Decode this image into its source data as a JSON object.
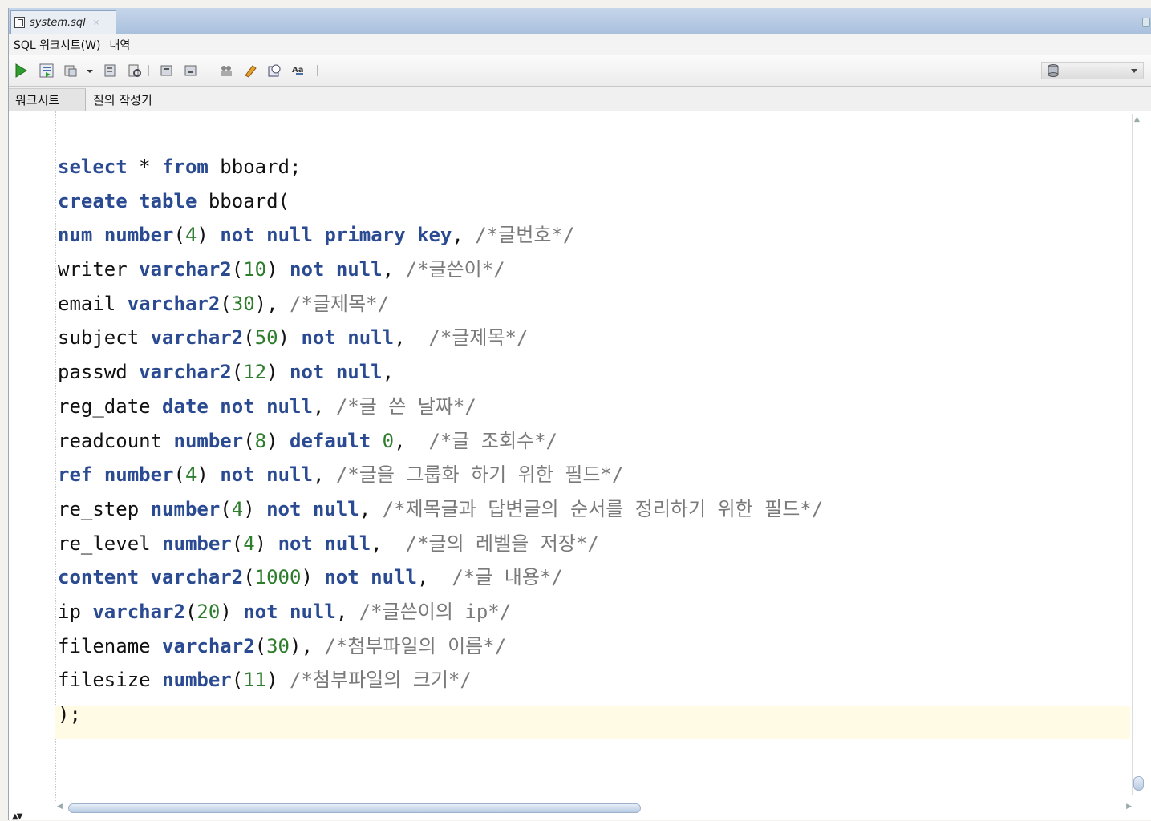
{
  "file_tab": {
    "name": "system.sql",
    "close": "×",
    "icon": "sql-file-icon"
  },
  "menu": {
    "items": [
      "SQL 워크시트(W)",
      "내역"
    ]
  },
  "toolbar": {
    "buttons": [
      "run-statement-icon",
      "run-script-icon",
      "autotrace-icon",
      "dropdown-icon",
      "explain-plan-icon",
      "sql-tuning-icon",
      "commit-icon",
      "rollback-icon",
      "unshared-worksheet-icon",
      "clear-icon",
      "sql-history-icon",
      "format-icon"
    ],
    "connection_icon": "database-icon",
    "connection_value": ""
  },
  "subtabs": {
    "worksheet": "워크시트",
    "query_builder": "질의 작성기"
  },
  "editor": {
    "lines": [
      [
        [
          "kw",
          "select"
        ],
        [
          "t",
          " * "
        ],
        [
          "kw",
          "from"
        ],
        [
          "t",
          " bboard;"
        ]
      ],
      [
        [
          "kw",
          "create"
        ],
        [
          "t",
          " "
        ],
        [
          "kw",
          "table"
        ],
        [
          "t",
          " bboard("
        ]
      ],
      [
        [
          "kw",
          "num"
        ],
        [
          "t",
          " "
        ],
        [
          "kw",
          "number"
        ],
        [
          "t",
          "("
        ],
        [
          "num",
          "4"
        ],
        [
          "t",
          ") "
        ],
        [
          "kw",
          "not"
        ],
        [
          "t",
          " "
        ],
        [
          "kw",
          "null"
        ],
        [
          "t",
          " "
        ],
        [
          "kw",
          "primary"
        ],
        [
          "t",
          " "
        ],
        [
          "kw",
          "key"
        ],
        [
          "t",
          ", "
        ],
        [
          "cm",
          "/*글번호*/"
        ]
      ],
      [
        [
          "t",
          "writer "
        ],
        [
          "kw",
          "varchar2"
        ],
        [
          "t",
          "("
        ],
        [
          "num",
          "10"
        ],
        [
          "t",
          ") "
        ],
        [
          "kw",
          "not"
        ],
        [
          "t",
          " "
        ],
        [
          "kw",
          "null"
        ],
        [
          "t",
          ", "
        ],
        [
          "cm",
          "/*글쓴이*/"
        ]
      ],
      [
        [
          "t",
          "email "
        ],
        [
          "kw",
          "varchar2"
        ],
        [
          "t",
          "("
        ],
        [
          "num",
          "30"
        ],
        [
          "t",
          "), "
        ],
        [
          "cm",
          "/*글제목*/"
        ]
      ],
      [
        [
          "t",
          "subject "
        ],
        [
          "kw",
          "varchar2"
        ],
        [
          "t",
          "("
        ],
        [
          "num",
          "50"
        ],
        [
          "t",
          ") "
        ],
        [
          "kw",
          "not"
        ],
        [
          "t",
          " "
        ],
        [
          "kw",
          "null"
        ],
        [
          "t",
          ",  "
        ],
        [
          "cm",
          "/*글제목*/"
        ]
      ],
      [
        [
          "t",
          "passwd "
        ],
        [
          "kw",
          "varchar2"
        ],
        [
          "t",
          "("
        ],
        [
          "num",
          "12"
        ],
        [
          "t",
          ") "
        ],
        [
          "kw",
          "not"
        ],
        [
          "t",
          " "
        ],
        [
          "kw",
          "null"
        ],
        [
          "t",
          ","
        ]
      ],
      [
        [
          "t",
          "reg_date "
        ],
        [
          "kw",
          "date"
        ],
        [
          "t",
          " "
        ],
        [
          "kw",
          "not"
        ],
        [
          "t",
          " "
        ],
        [
          "kw",
          "null"
        ],
        [
          "t",
          ", "
        ],
        [
          "cm",
          "/*글 쓴 날짜*/"
        ]
      ],
      [
        [
          "t",
          "readcount "
        ],
        [
          "kw",
          "number"
        ],
        [
          "t",
          "("
        ],
        [
          "num",
          "8"
        ],
        [
          "t",
          ") "
        ],
        [
          "kw",
          "default"
        ],
        [
          "t",
          " "
        ],
        [
          "num",
          "0"
        ],
        [
          "t",
          ",  "
        ],
        [
          "cm",
          "/*글 조회수*/"
        ]
      ],
      [
        [
          "kw",
          "ref"
        ],
        [
          "t",
          " "
        ],
        [
          "kw",
          "number"
        ],
        [
          "t",
          "("
        ],
        [
          "num",
          "4"
        ],
        [
          "t",
          ") "
        ],
        [
          "kw",
          "not"
        ],
        [
          "t",
          " "
        ],
        [
          "kw",
          "null"
        ],
        [
          "t",
          ", "
        ],
        [
          "cm",
          "/*글을 그룹화 하기 위한 필드*/"
        ]
      ],
      [
        [
          "t",
          "re_step "
        ],
        [
          "kw",
          "number"
        ],
        [
          "t",
          "("
        ],
        [
          "num",
          "4"
        ],
        [
          "t",
          ") "
        ],
        [
          "kw",
          "not"
        ],
        [
          "t",
          " "
        ],
        [
          "kw",
          "null"
        ],
        [
          "t",
          ", "
        ],
        [
          "cm",
          "/*제목글과 답변글의 순서를 정리하기 위한 필드*/"
        ]
      ],
      [
        [
          "t",
          "re_level "
        ],
        [
          "kw",
          "number"
        ],
        [
          "t",
          "("
        ],
        [
          "num",
          "4"
        ],
        [
          "t",
          ") "
        ],
        [
          "kw",
          "not"
        ],
        [
          "t",
          " "
        ],
        [
          "kw",
          "null"
        ],
        [
          "t",
          ",  "
        ],
        [
          "cm",
          "/*글의 레벨을 저장*/"
        ]
      ],
      [
        [
          "kw",
          "content"
        ],
        [
          "t",
          " "
        ],
        [
          "kw",
          "varchar2"
        ],
        [
          "t",
          "("
        ],
        [
          "num",
          "1000"
        ],
        [
          "t",
          ") "
        ],
        [
          "kw",
          "not"
        ],
        [
          "t",
          " "
        ],
        [
          "kw",
          "null"
        ],
        [
          "t",
          ",  "
        ],
        [
          "cm",
          "/*글 내용*/"
        ]
      ],
      [
        [
          "t",
          "ip "
        ],
        [
          "kw",
          "varchar2"
        ],
        [
          "t",
          "("
        ],
        [
          "num",
          "20"
        ],
        [
          "t",
          ") "
        ],
        [
          "kw",
          "not"
        ],
        [
          "t",
          " "
        ],
        [
          "kw",
          "null"
        ],
        [
          "t",
          ", "
        ],
        [
          "cm",
          "/*글쓴이의 ip*/"
        ]
      ],
      [
        [
          "t",
          "filename "
        ],
        [
          "kw",
          "varchar2"
        ],
        [
          "t",
          "("
        ],
        [
          "num",
          "30"
        ],
        [
          "t",
          "), "
        ],
        [
          "cm",
          "/*첨부파일의 이름*/"
        ]
      ],
      [
        [
          "t",
          "filesize "
        ],
        [
          "kw",
          "number"
        ],
        [
          "t",
          "("
        ],
        [
          "num",
          "11"
        ],
        [
          "t",
          ") "
        ],
        [
          "cm",
          "/*첨부파일의 크기*/"
        ]
      ],
      [
        [
          "t",
          ");"
        ]
      ]
    ]
  },
  "scrollbars": {
    "up": "▲",
    "left": "◀",
    "right": "▶"
  },
  "bottom_control": "▲▼",
  "colors": {
    "keyword": "#2a4a91",
    "number": "#2d7d2d",
    "comment": "#7a7a7a",
    "current_line": "#fffbe4",
    "tab_bar": "#b5c9e2"
  }
}
